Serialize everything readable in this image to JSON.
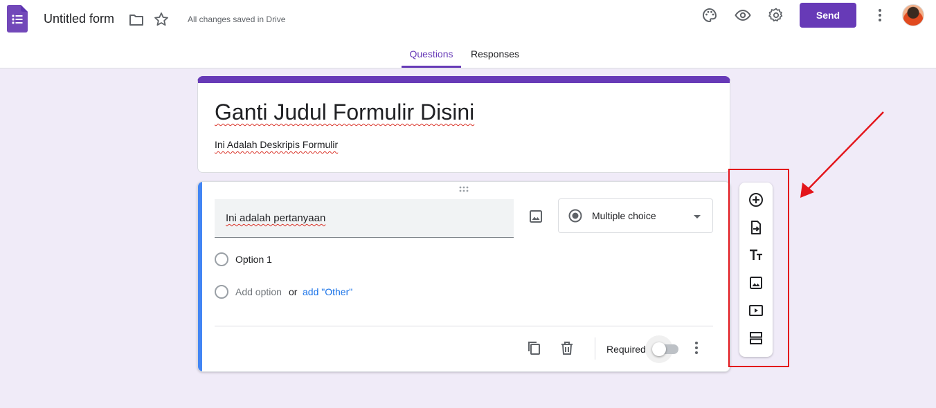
{
  "header": {
    "form_title": "Untitled form",
    "save_status": "All changes saved in Drive",
    "send_label": "Send",
    "brand_color": "#673ab7"
  },
  "tabs": [
    {
      "label": "Questions",
      "active": true
    },
    {
      "label": "Responses",
      "active": false
    }
  ],
  "title_card": {
    "title": "Ganti Judul Formulir Disini",
    "description": "Ini Adalah Deskripis Formulir"
  },
  "question": {
    "text": "Ini adalah pertanyaan",
    "type_label": "Multiple choice",
    "options": [
      "Option 1"
    ],
    "add_option": "Add option",
    "or_text": "or",
    "add_other": "add \"Other\"",
    "required_label": "Required",
    "required": false,
    "accent_color": "#4285f4"
  },
  "side_toolbar": {
    "icons": [
      "add-question-icon",
      "import-questions-icon",
      "add-title-icon",
      "add-image-icon",
      "add-video-icon",
      "add-section-icon"
    ]
  },
  "annotation": {
    "color": "#e3151b"
  }
}
